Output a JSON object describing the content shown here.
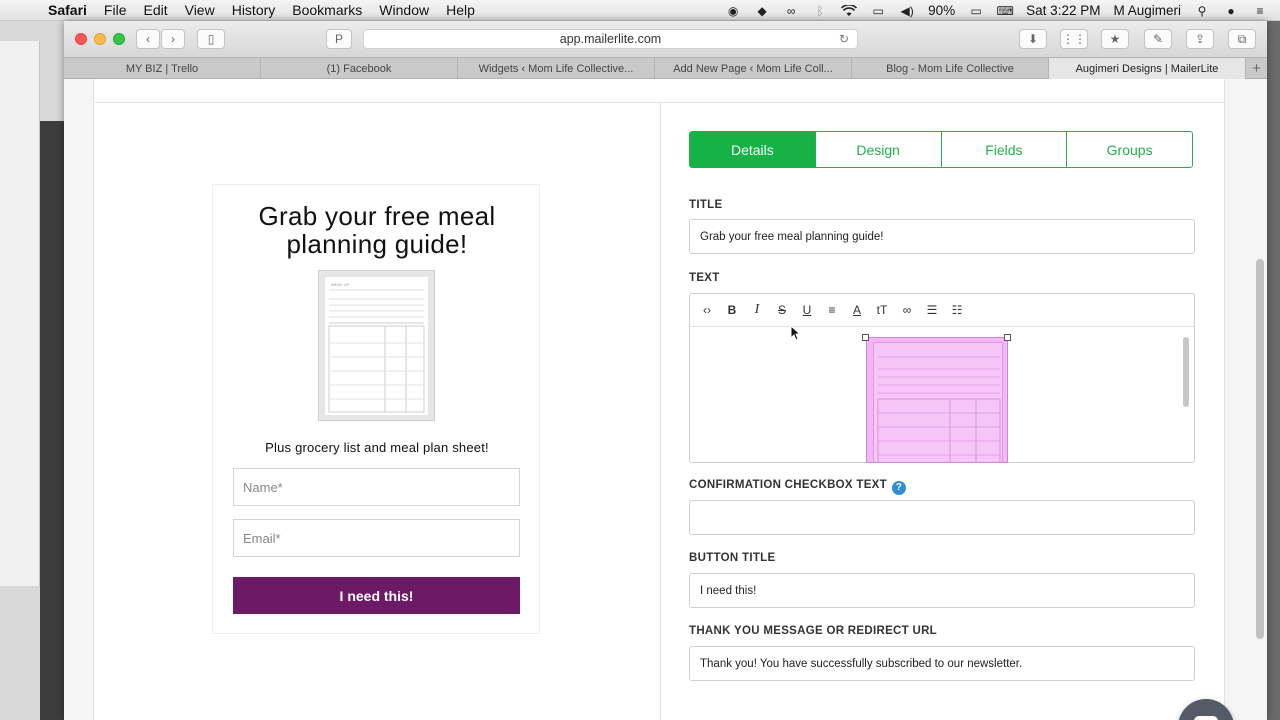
{
  "menubar": {
    "app": "Safari",
    "items": [
      "File",
      "Edit",
      "View",
      "History",
      "Bookmarks",
      "Window",
      "Help"
    ],
    "battery": "90%",
    "clock": "Sat 3:22 PM",
    "user": "M Augimeri"
  },
  "browser": {
    "url": "app.mailerlite.com",
    "tabs": [
      {
        "label": "MY BIZ | Trello"
      },
      {
        "label": "(1) Facebook"
      },
      {
        "label": "Widgets ‹ Mom Life Collective..."
      },
      {
        "label": "Add New Page ‹ Mom Life Coll..."
      },
      {
        "label": "Blog - Mom Life Collective"
      },
      {
        "label": "Augimeri Designs | MailerLite"
      }
    ],
    "active_tab": 5
  },
  "preview": {
    "title": "Grab your free meal planning guide!",
    "subtitle": "Plus grocery list and meal plan sheet!",
    "name_placeholder": "Name*",
    "email_placeholder": "Email*",
    "button": "I need this!",
    "button_color": "#6c1a66"
  },
  "settings": {
    "tabs": [
      "Details",
      "Design",
      "Fields",
      "Groups"
    ],
    "active_tab": "Details",
    "accent": "#17b245",
    "title_label": "TITLE",
    "title_value": "Grab your free meal planning guide!",
    "text_label": "TEXT",
    "toolbar_icons": [
      "code-icon",
      "bold-icon",
      "italic-icon",
      "strikethrough-icon",
      "underline-icon",
      "align-icon",
      "text-color-icon",
      "font-size-icon",
      "link-icon",
      "bullet-list-icon",
      "numbered-list-icon"
    ],
    "confirm_label": "CONFIRMATION CHECKBOX TEXT",
    "confirm_value": "",
    "button_label": "BUTTON TITLE",
    "button_value": "I need this!",
    "thanks_label": "THANK YOU MESSAGE OR REDIRECT URL",
    "thanks_value": "Thank you! You have successfully subscribed to our newsletter."
  }
}
